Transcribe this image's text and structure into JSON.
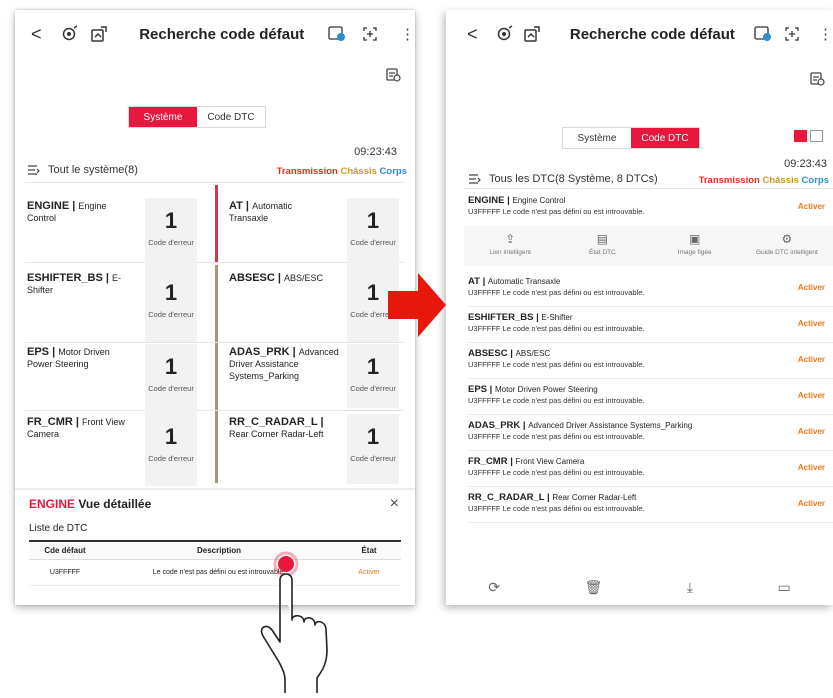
{
  "left": {
    "header": {
      "back": "<",
      "title": "Recherche code défaut",
      "more": "⋮"
    },
    "tabs": [
      {
        "label": "Système",
        "active": true
      },
      {
        "label": "Code DTC",
        "active": false
      }
    ],
    "time": "09:23:43",
    "system_label": "Tout le système(8)",
    "filters": {
      "transmission": "Transmission",
      "chassis": "Châssis",
      "corps": "Corps"
    },
    "error_label": "Code d'erreur",
    "cards": [
      {
        "name": "ENGINE",
        "desc": "Engine Control",
        "count": "1"
      },
      {
        "name": "AT",
        "desc": "Automatic Transaxle",
        "count": "1"
      },
      {
        "name": "ESHIFTER_BS",
        "desc": "E-Shifter",
        "count": "1"
      },
      {
        "name": "ABSESC",
        "desc": "ABS/ESC",
        "count": "1"
      },
      {
        "name": "EPS",
        "desc": "Motor Driven Power Steering",
        "count": "1"
      },
      {
        "name": "ADAS_PRK",
        "desc": "Advanced Driver Assistance Systems_Parking",
        "count": "1"
      },
      {
        "name": "FR_CMR",
        "desc": "Front View Camera",
        "count": "1"
      },
      {
        "name": "RR_C_RADAR_L",
        "desc": "Rear Corner Radar-Left",
        "count": "1"
      }
    ],
    "detail": {
      "title_red": "ENGINE",
      "title_rest": "Vue détaillée",
      "close": "×",
      "subtitle": "Liste de DTC",
      "columns": [
        "Cde défaut",
        "Description",
        "État"
      ],
      "rows": [
        {
          "code": "U3FFFFF",
          "description": "Le code n'est pas défini ou est introuvable.",
          "state": "Activer"
        }
      ]
    }
  },
  "right": {
    "header": {
      "back": "<",
      "title": "Recherche code défaut",
      "more": "⋮"
    },
    "tabs": [
      {
        "label": "Système",
        "active": false
      },
      {
        "label": "Code DTC",
        "active": true
      }
    ],
    "time": "09:23:43",
    "summary": "Tous les DTC(8 Système, 8 DTCs)",
    "filters": {
      "transmission": "Transmission",
      "chassis": "Châssis",
      "corps": "Corps"
    },
    "first_item": {
      "system": "ENGINE",
      "desc": "Engine Control",
      "code_text": "U3FFFFF Le code n'est pas défini ou est introuvable.",
      "status": "Activer"
    },
    "actions": [
      "Lien intelligent",
      "État DTC",
      "Image figée",
      "Guide DTC intelligent"
    ],
    "items": [
      {
        "system": "AT",
        "desc": "Automatic Transaxle",
        "code_text": "U3FFFFF Le code n'est pas défini ou est introuvable.",
        "status": "Activer"
      },
      {
        "system": "ESHIFTER_BS",
        "desc": "E-Shifter",
        "code_text": "U3FFFFF Le code n'est pas défini ou est introuvable.",
        "status": "Activer"
      },
      {
        "system": "ABSESC",
        "desc": "ABS/ESC",
        "code_text": "U3FFFFF Le code n'est pas défini ou est introuvable.",
        "status": "Activer"
      },
      {
        "system": "EPS",
        "desc": "Motor Driven Power Steering",
        "code_text": "U3FFFFF Le code n'est pas défini ou est introuvable.",
        "status": "Activer"
      },
      {
        "system": "ADAS_PRK",
        "desc": "Advanced Driver Assistance Systems_Parking",
        "code_text": "U3FFFFF Le code n'est pas défini ou est introuvable.",
        "status": "Activer"
      },
      {
        "system": "FR_CMR",
        "desc": "Front View Camera",
        "code_text": "U3FFFFF Le code n'est pas défini ou est introuvable.",
        "status": "Activer"
      },
      {
        "system": "RR_C_RADAR_L",
        "desc": "Rear Corner Radar-Left",
        "code_text": "U3FFFFF Le code n'est pas défini ou est introuvable.",
        "status": "Activer"
      }
    ]
  },
  "colors": {
    "accent": "#e8173d",
    "active_status": "#e37c1a",
    "transmission": "#e0301e",
    "chassis": "#c79a2a",
    "corps": "#2a8fd0",
    "arrow": "#e8170c"
  }
}
